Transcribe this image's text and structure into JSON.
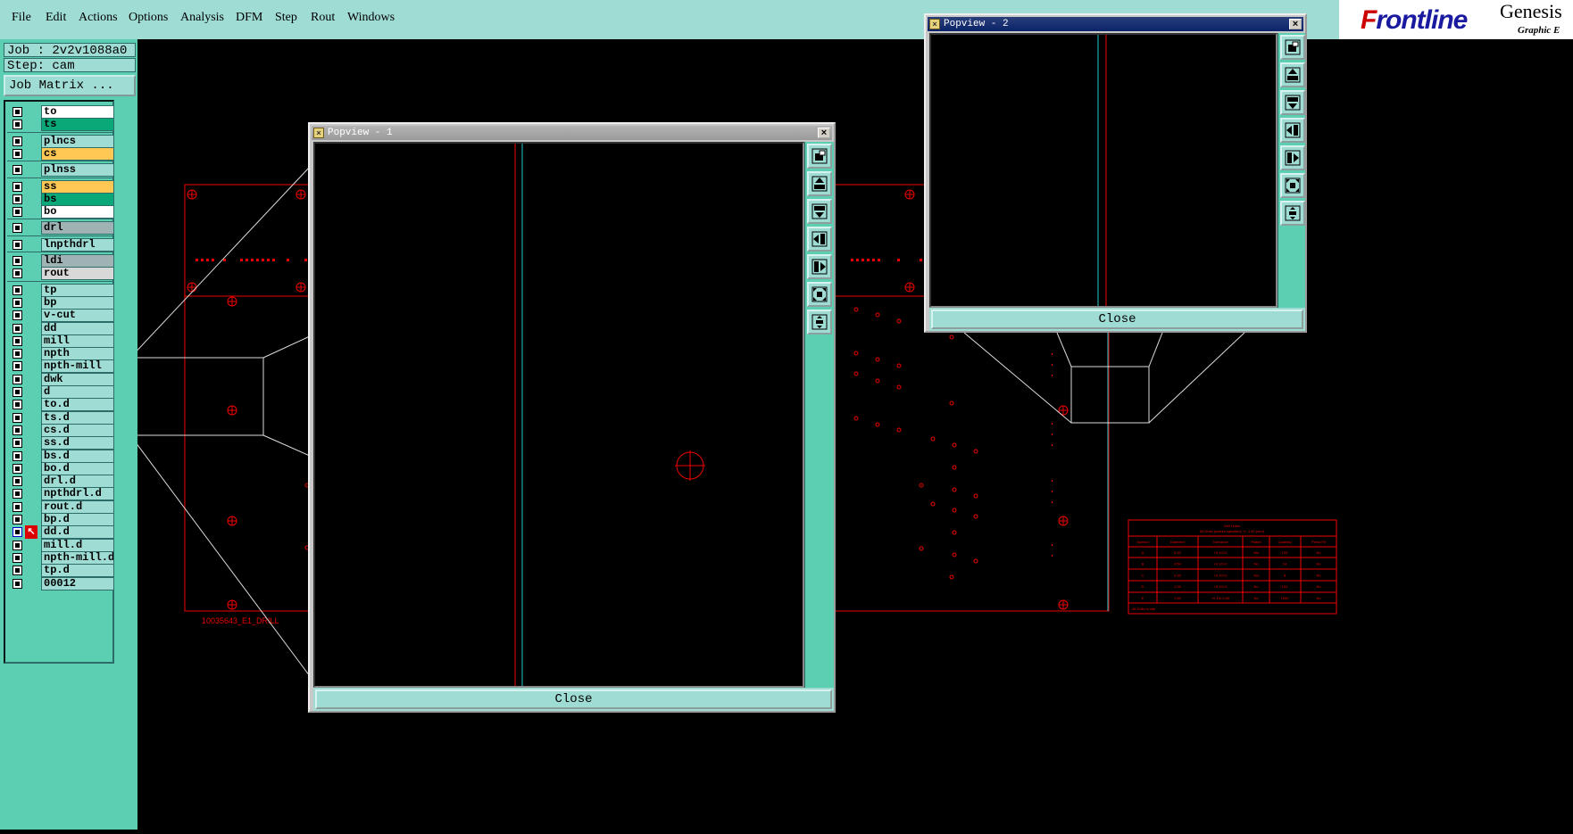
{
  "menu": [
    "File",
    "Edit",
    "Actions",
    "Options",
    "Analysis",
    "DFM",
    "Step",
    "Rout",
    "Windows"
  ],
  "brand": {
    "name": "Genesis",
    "subtitle": "Graphic E"
  },
  "job": {
    "job_label": "Job : 2v2v1088a0",
    "step_label": "Step: cam",
    "matrix_button": "Job Matrix ..."
  },
  "layers": [
    {
      "name": "to",
      "color": "#ffffff"
    },
    {
      "name": "ts",
      "color": "#0aa878"
    },
    {
      "name": "plncs",
      "color": "#9fdcd4"
    },
    {
      "name": "cs",
      "color": "#ffc855"
    },
    {
      "name": "plnss",
      "color": "#9fdcd4"
    },
    {
      "name": "ss",
      "color": "#ffc855"
    },
    {
      "name": "bs",
      "color": "#0aa878"
    },
    {
      "name": "bo",
      "color": "#ffffff"
    },
    {
      "name": "drl",
      "color": "#9fb2b4"
    },
    {
      "name": "lnpthdrl",
      "color": "#9fdcd4"
    },
    {
      "name": "ldi",
      "color": "#9fb2b4"
    },
    {
      "name": "rout",
      "color": "#d8d8d8"
    },
    {
      "name": "tp",
      "color": "#9fdcd4"
    },
    {
      "name": "bp",
      "color": "#9fdcd4"
    },
    {
      "name": "v-cut",
      "color": "#9fdcd4"
    },
    {
      "name": "dd",
      "color": "#9fdcd4"
    },
    {
      "name": "mill",
      "color": "#9fdcd4"
    },
    {
      "name": "npth",
      "color": "#9fdcd4"
    },
    {
      "name": "npth-mill",
      "color": "#9fdcd4"
    },
    {
      "name": "dwk",
      "color": "#9fdcd4"
    },
    {
      "name": "d",
      "color": "#9fdcd4"
    },
    {
      "name": "to.d",
      "color": "#9fdcd4"
    },
    {
      "name": "ts.d",
      "color": "#9fdcd4"
    },
    {
      "name": "cs.d",
      "color": "#9fdcd4"
    },
    {
      "name": "ss.d",
      "color": "#9fdcd4"
    },
    {
      "name": "bs.d",
      "color": "#9fdcd4"
    },
    {
      "name": "bo.d",
      "color": "#9fdcd4"
    },
    {
      "name": "drl.d",
      "color": "#9fdcd4"
    },
    {
      "name": "npthdrl.d",
      "color": "#9fdcd4"
    },
    {
      "name": "rout.d",
      "color": "#9fdcd4"
    },
    {
      "name": "bp.d",
      "color": "#9fdcd4"
    },
    {
      "name": "dd.d",
      "color": "#9fdcd4",
      "active": true
    },
    {
      "name": "mill.d",
      "color": "#9fdcd4"
    },
    {
      "name": "npth-mill.d",
      "color": "#9fdcd4"
    },
    {
      "name": "tp.d",
      "color": "#9fdcd4"
    },
    {
      "name": "00012",
      "color": "#9fdcd4"
    }
  ],
  "canvas": {
    "drill_label": "10035643_E1_DRILL"
  },
  "popview1": {
    "title": "Popview - 1",
    "close_label": "Close"
  },
  "popview2": {
    "title": "Popview - 2",
    "close_label": "Close"
  },
  "toolbar_icons": [
    "zoom-home-icon",
    "pan-up-icon",
    "pan-down-icon",
    "pan-left-icon",
    "pan-right-icon",
    "zoom-in-icon",
    "zoom-out-icon"
  ],
  "drill_table": {
    "title": "Drill Holes",
    "subtitle": "All Units (unless specified) +/- 1.00 (mm)",
    "headers": [
      "Symbol",
      "Diameter",
      "Tolerance",
      "Plated",
      "Quantity",
      "Press Fit"
    ],
    "rows": [
      [
        "A",
        "0.20",
        "+0.10/-0",
        "Yes",
        "125",
        "No"
      ],
      [
        "B",
        "0.50",
        "+0.10/-0",
        "No",
        "24",
        "No"
      ],
      [
        "C",
        "0.35",
        "+0.10/-0",
        "Yes",
        "8",
        "No"
      ],
      [
        "D",
        "1.00",
        "+0.10/-0",
        "No",
        "104",
        "No"
      ],
      [
        "E",
        "1.50",
        "+0.10/-0.00",
        "No",
        "1000",
        "No"
      ]
    ],
    "footer": "All Drills to site"
  }
}
